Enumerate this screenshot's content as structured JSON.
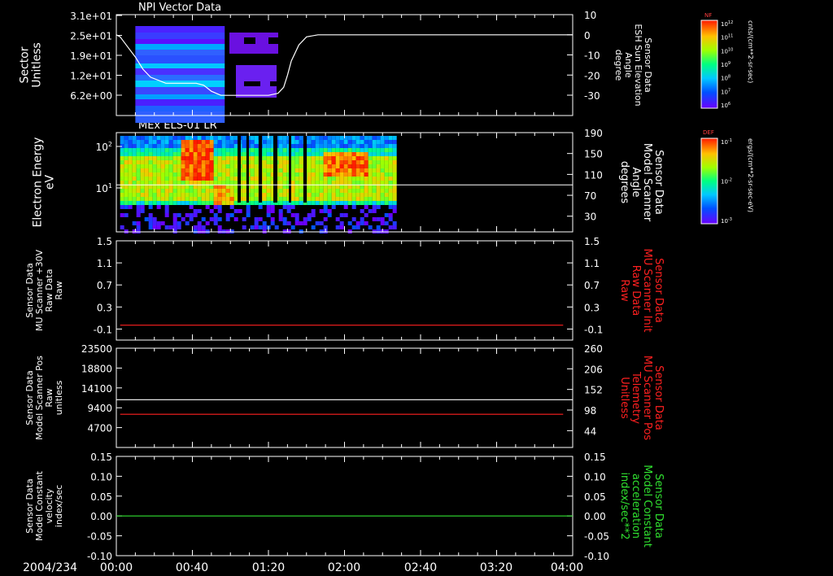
{
  "date_label": "2004/234",
  "time_axis": {
    "tick_labels": [
      "00:00",
      "00:40",
      "01:20",
      "02:00",
      "02:40",
      "03:20",
      "04:00"
    ],
    "range_minutes": [
      0,
      240
    ]
  },
  "colors": {
    "background": "#000000",
    "axes": "#ffffff",
    "red_trace": "#ff2020",
    "green_trace": "#30e030"
  },
  "colorbars": [
    {
      "name": "NF",
      "unit": "cnts/(cm**2-sr-sec)",
      "ticks": [
        "10^12",
        "10^11",
        "10^10",
        "10^9",
        "10^8",
        "10^7",
        "10^6"
      ]
    },
    {
      "name": "DEF",
      "unit": "ergs/(cm**2-sr-sec-eV)",
      "ticks": [
        "10^-1",
        "10^-2",
        "10^-3"
      ]
    }
  ],
  "chart_data": [
    {
      "type": "heatmap",
      "title": "NPI Vector Data",
      "ylabel": [
        "Sector",
        "Unitless"
      ],
      "y_ticks": [
        "3.1e+01",
        "2.5e+01",
        "1.9e+01",
        "1.2e+01",
        "6.2e+00"
      ],
      "y2label": [
        "Sensor Data",
        "ESH Sun Elevation",
        "Angle",
        "degree"
      ],
      "y2_ticks": [
        "10",
        "0",
        "-10",
        "-20",
        "-30"
      ],
      "y2_range": [
        10,
        -40
      ],
      "data_span_minutes": [
        10,
        57
      ],
      "overlay_line": {
        "name": "ESH Sun Elevation Angle",
        "x_minutes": [
          0,
          2,
          6,
          10,
          14,
          18,
          26,
          28,
          30,
          34,
          38,
          42,
          46,
          50,
          55,
          60,
          65,
          70,
          75,
          80,
          85,
          88,
          90,
          92,
          96,
          100,
          106,
          240
        ],
        "values": [
          0,
          -1,
          -6,
          -11,
          -17,
          -21,
          -24,
          -24,
          -24,
          -24,
          -24,
          -24,
          -25,
          -28,
          -30,
          -30,
          -30,
          -30,
          -30,
          -30,
          -29,
          -26,
          -20,
          -13,
          -5,
          -1,
          0,
          0
        ]
      }
    },
    {
      "type": "heatmap",
      "title": "MEx ELS-01 LR",
      "ylabel": [
        "Electron Energy",
        "eV"
      ],
      "y_ticks": [
        "10^2",
        "10^1"
      ],
      "y2label": [
        "Sensor Data",
        "Model Scanner",
        "Angle",
        "degrees"
      ],
      "y2_ticks": [
        "190",
        "150",
        "110",
        "70",
        "30"
      ],
      "y2_range": [
        190,
        0
      ],
      "data_span_minutes": [
        2,
        147
      ],
      "overlay_line": {
        "name": "Model Scanner Angle",
        "value": 90
      }
    },
    {
      "type": "line",
      "ylabel": [
        "Sensor Data",
        "MU Scanner +30V",
        "Raw Data",
        "Raw"
      ],
      "y_ticks": [
        "1.5",
        "1.1",
        "0.7",
        "0.3",
        "-0.1"
      ],
      "ylim": [
        -0.3,
        1.5
      ],
      "y2label": [
        "Sensor Data",
        "MU Scanner Init",
        "Raw Data",
        "Raw"
      ],
      "y2_ticks": [
        "1.5",
        "1.1",
        "0.7",
        "0.3",
        "-0.1"
      ],
      "series": [
        {
          "x_minutes": [
            2,
            235
          ],
          "values": [
            -0.03,
            -0.03
          ],
          "color": "#ff2020"
        }
      ]
    },
    {
      "type": "line",
      "ylabel": [
        "Sensor Data",
        "Model Scanner Pos",
        "Raw",
        "unitless"
      ],
      "y_ticks": [
        "23500",
        "18800",
        "14100",
        "9400",
        "4700"
      ],
      "ylim": [
        0,
        23500
      ],
      "y2label": [
        "Sensor Data",
        "MU Scanner Pos",
        "Telemetry",
        "Unitless"
      ],
      "y2_ticks": [
        "260",
        "206",
        "152",
        "98",
        "44"
      ],
      "y2lim": [
        0,
        260
      ],
      "series": [
        {
          "x_minutes": [
            0,
            240
          ],
          "values": [
            11300,
            11300
          ],
          "color": "#ffffff"
        },
        {
          "x_minutes": [
            2,
            235
          ],
          "values": [
            87,
            87
          ],
          "axis": "right",
          "color": "#ff2020"
        }
      ]
    },
    {
      "type": "line",
      "ylabel": [
        "Sensor Data",
        "Model Constant",
        "velocity",
        "index/sec"
      ],
      "y_ticks": [
        "0.15",
        "0.10",
        "0.05",
        "0.00",
        "-0.05",
        "-0.10"
      ],
      "ylim": [
        -0.1,
        0.15
      ],
      "y2label": [
        "Sensor Data",
        "Model Constant",
        "acceleration",
        "index/sec**2"
      ],
      "y2_ticks": [
        "0.15",
        "0.10",
        "0.05",
        "0.00",
        "-0.05",
        "-0.10"
      ],
      "series": [
        {
          "x_minutes": [
            0,
            240
          ],
          "values": [
            0,
            0
          ],
          "color": "#30e030"
        }
      ]
    }
  ]
}
